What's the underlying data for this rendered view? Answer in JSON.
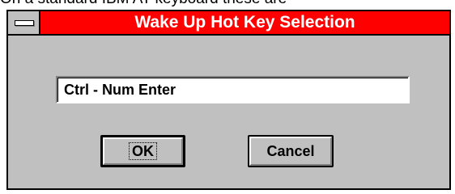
{
  "background": {
    "text": "On a standard IBM AT keyboard these are"
  },
  "dialog": {
    "title": "Wake Up Hot Key Selection",
    "system_menu_icon": "system-menu-icon",
    "hotkey_value": "Ctrl - Num Enter",
    "ok_label": "OK",
    "cancel_label": "Cancel"
  },
  "colors": {
    "title_bar": "#ff0000",
    "dialog_face": "#c0c0c0",
    "title_text": "#ffffff"
  }
}
